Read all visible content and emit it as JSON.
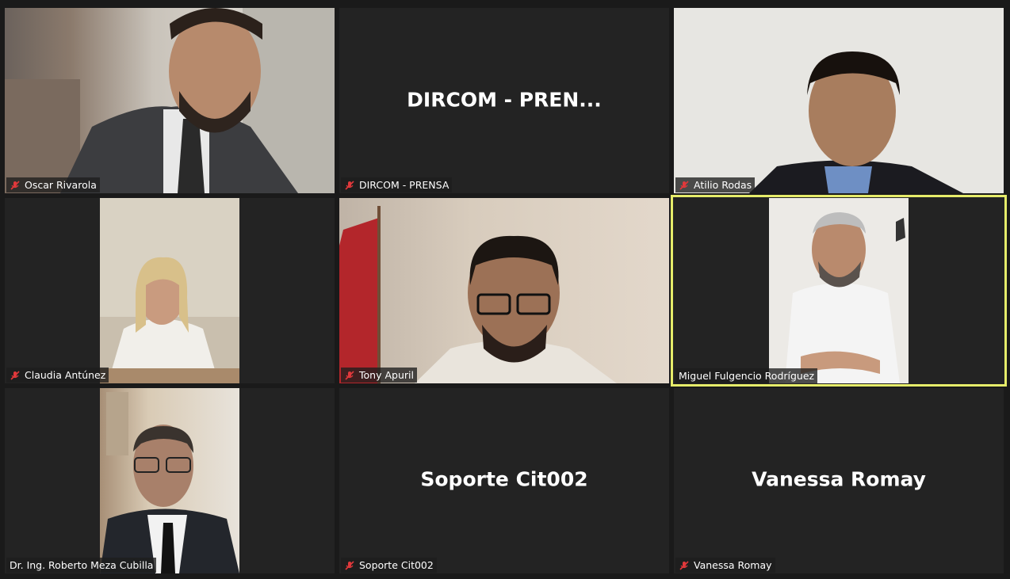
{
  "app": "Zoom gallery view",
  "accent_active": "#e6ec6a",
  "participants": [
    {
      "name": "Oscar Rivarola",
      "muted": true,
      "video": true
    },
    {
      "name": "DIRCOM - PRENSA",
      "display": "DIRCOM  -  PREN...",
      "muted": true,
      "video": false
    },
    {
      "name": "Atilio Rodas",
      "muted": true,
      "video": true
    },
    {
      "name": "Claudia Antúnez",
      "muted": true,
      "video": true
    },
    {
      "name": "Tony Apuril",
      "muted": true,
      "video": true
    },
    {
      "name": "Miguel Fulgencio Rodríguez",
      "muted": false,
      "video": true,
      "active_speaker": true
    },
    {
      "name": "Dr. Ing. Roberto Meza Cubilla",
      "muted": false,
      "video": true
    },
    {
      "name": "Soporte Cit002",
      "display": "Soporte Cit002",
      "muted": true,
      "video": false
    },
    {
      "name": "Vanessa Romay",
      "display": "Vanessa Romay",
      "muted": true,
      "video": false
    }
  ],
  "icons": {
    "muted": "mic-muted-icon"
  }
}
